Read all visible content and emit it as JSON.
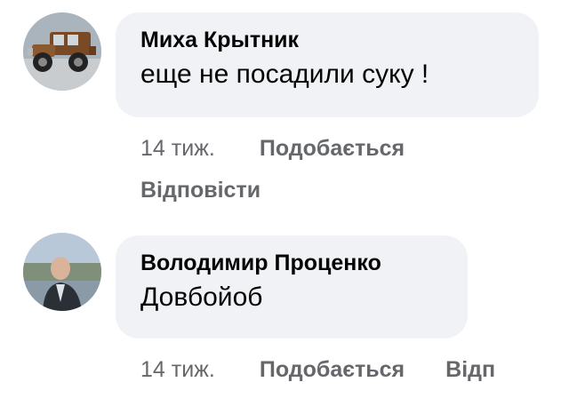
{
  "comments": [
    {
      "author": "Миха Крытник",
      "text": "еще не посадили суку !",
      "time": "14 тиж.",
      "like_label": "Подобається",
      "reply_label": "Відповісти",
      "avatar_icon": "vintage-car-photo"
    },
    {
      "author": "Володимир Проценко",
      "text": "Довбойоб",
      "time": "14 тиж.",
      "like_label": "Подобається",
      "reply_label": "Відп",
      "avatar_icon": "person-photo"
    }
  ],
  "colors": {
    "bubble": "#f0f2f5",
    "author_text": "#050505",
    "meta_text": "#65676b"
  }
}
